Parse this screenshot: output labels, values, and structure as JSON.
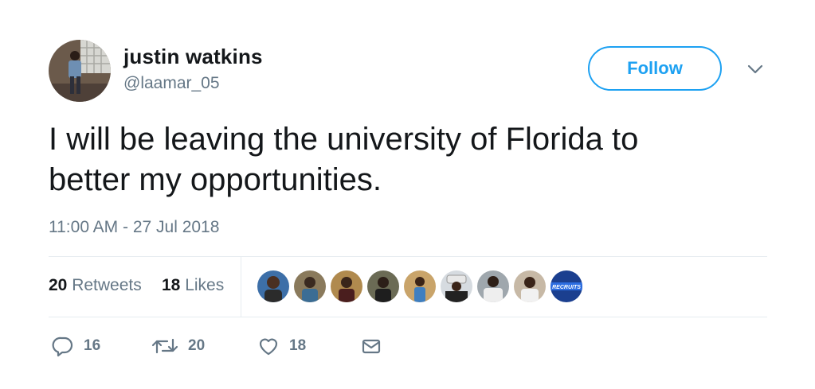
{
  "user": {
    "name": "justin watkins",
    "handle": "@laamar_05"
  },
  "follow_label": "Follow",
  "tweet": {
    "line1": "I will be leaving the university of Florida to",
    "line2": "better my opportunities.",
    "timestamp": "11:00 AM - 27 Jul 2018"
  },
  "stats": {
    "retweets_count": "20",
    "retweets_label": "Retweets",
    "likes_count": "18",
    "likes_label": "Likes"
  },
  "likers_badge_text": "RECRUITS",
  "actions": {
    "reply_count": "16",
    "retweet_count": "20",
    "like_count": "18"
  },
  "colors": {
    "accent": "#1da1f2",
    "secondary_text": "#657786",
    "primary_text": "#14171a",
    "divider": "#e6ecf0"
  },
  "icons": [
    "chevron-down-icon",
    "reply-icon",
    "retweet-icon",
    "heart-icon",
    "envelope-icon"
  ]
}
